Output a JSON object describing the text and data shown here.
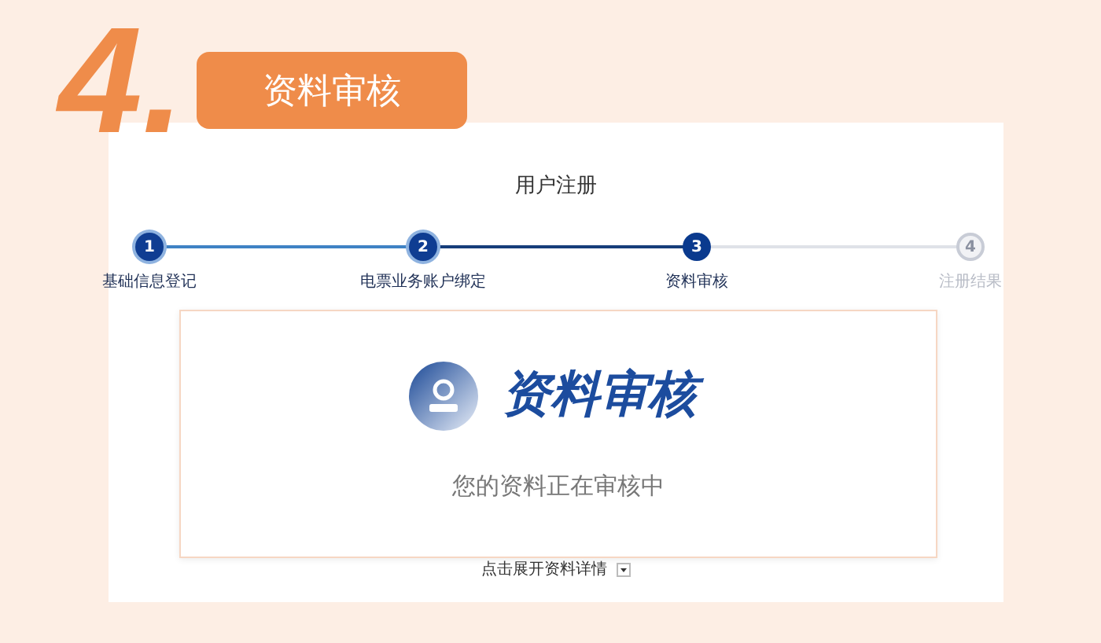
{
  "header": {
    "step_number": "4.",
    "title": "资料审核"
  },
  "page": {
    "title": "用户注册",
    "steps": [
      {
        "number": "1",
        "label": "基础信息登记",
        "kind": "done"
      },
      {
        "number": "2",
        "label": "电票业务账户绑定",
        "kind": "done"
      },
      {
        "number": "3",
        "label": "资料审核",
        "kind": "current"
      },
      {
        "number": "4",
        "label": "注册结果",
        "kind": "pending"
      }
    ]
  },
  "review_card": {
    "title": "资料审核",
    "message": "您的资料正在审核中"
  },
  "details_toggle": {
    "label": "点击展开资料详情",
    "expanded": false
  }
}
